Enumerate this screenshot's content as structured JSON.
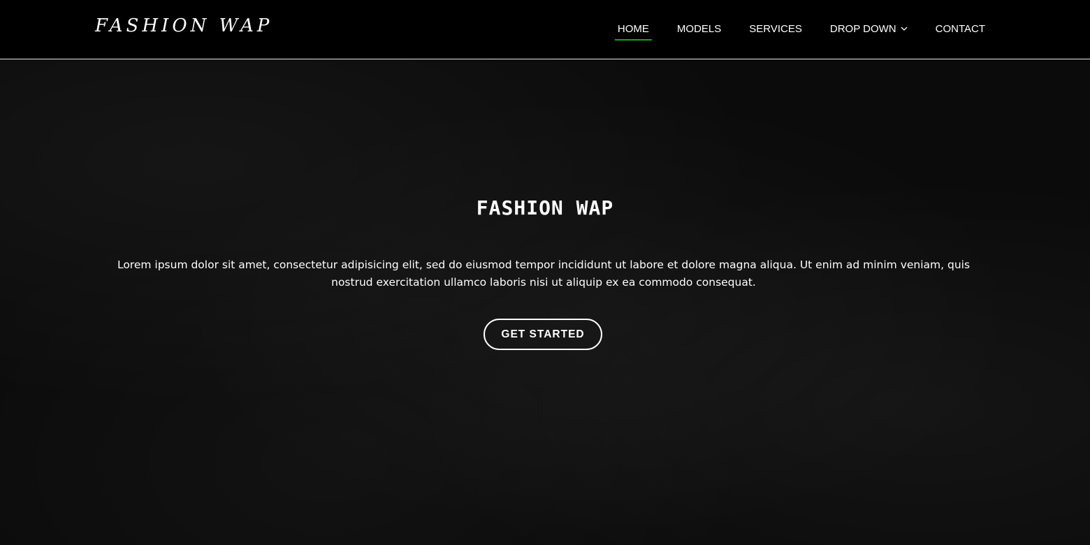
{
  "header": {
    "logo": "FASHION WAP",
    "nav": {
      "home": "HOME",
      "models": "MODELS",
      "services": "SERVICES",
      "dropdown": "DROP DOWN",
      "contact": "CONTACT"
    },
    "active_item": "HOME",
    "icons": {
      "dropdown": "chevron-down-icon"
    }
  },
  "hero": {
    "title": "FASHION WAP",
    "text": "Lorem ipsum dolor sit amet, consectetur adipisicing elit, sed do eiusmod tempor incididunt ut labore et dolore magna aliqua. Ut enim ad minim veniam, quis nostrud exercitation ullamco laboris nisi ut aliquip ex ea commodo consequat.",
    "button": "GET STARTED"
  },
  "colors": {
    "background": "#0b0b0b",
    "header_background": "#000000",
    "text": "#ffffff",
    "accent": "#16a516"
  }
}
